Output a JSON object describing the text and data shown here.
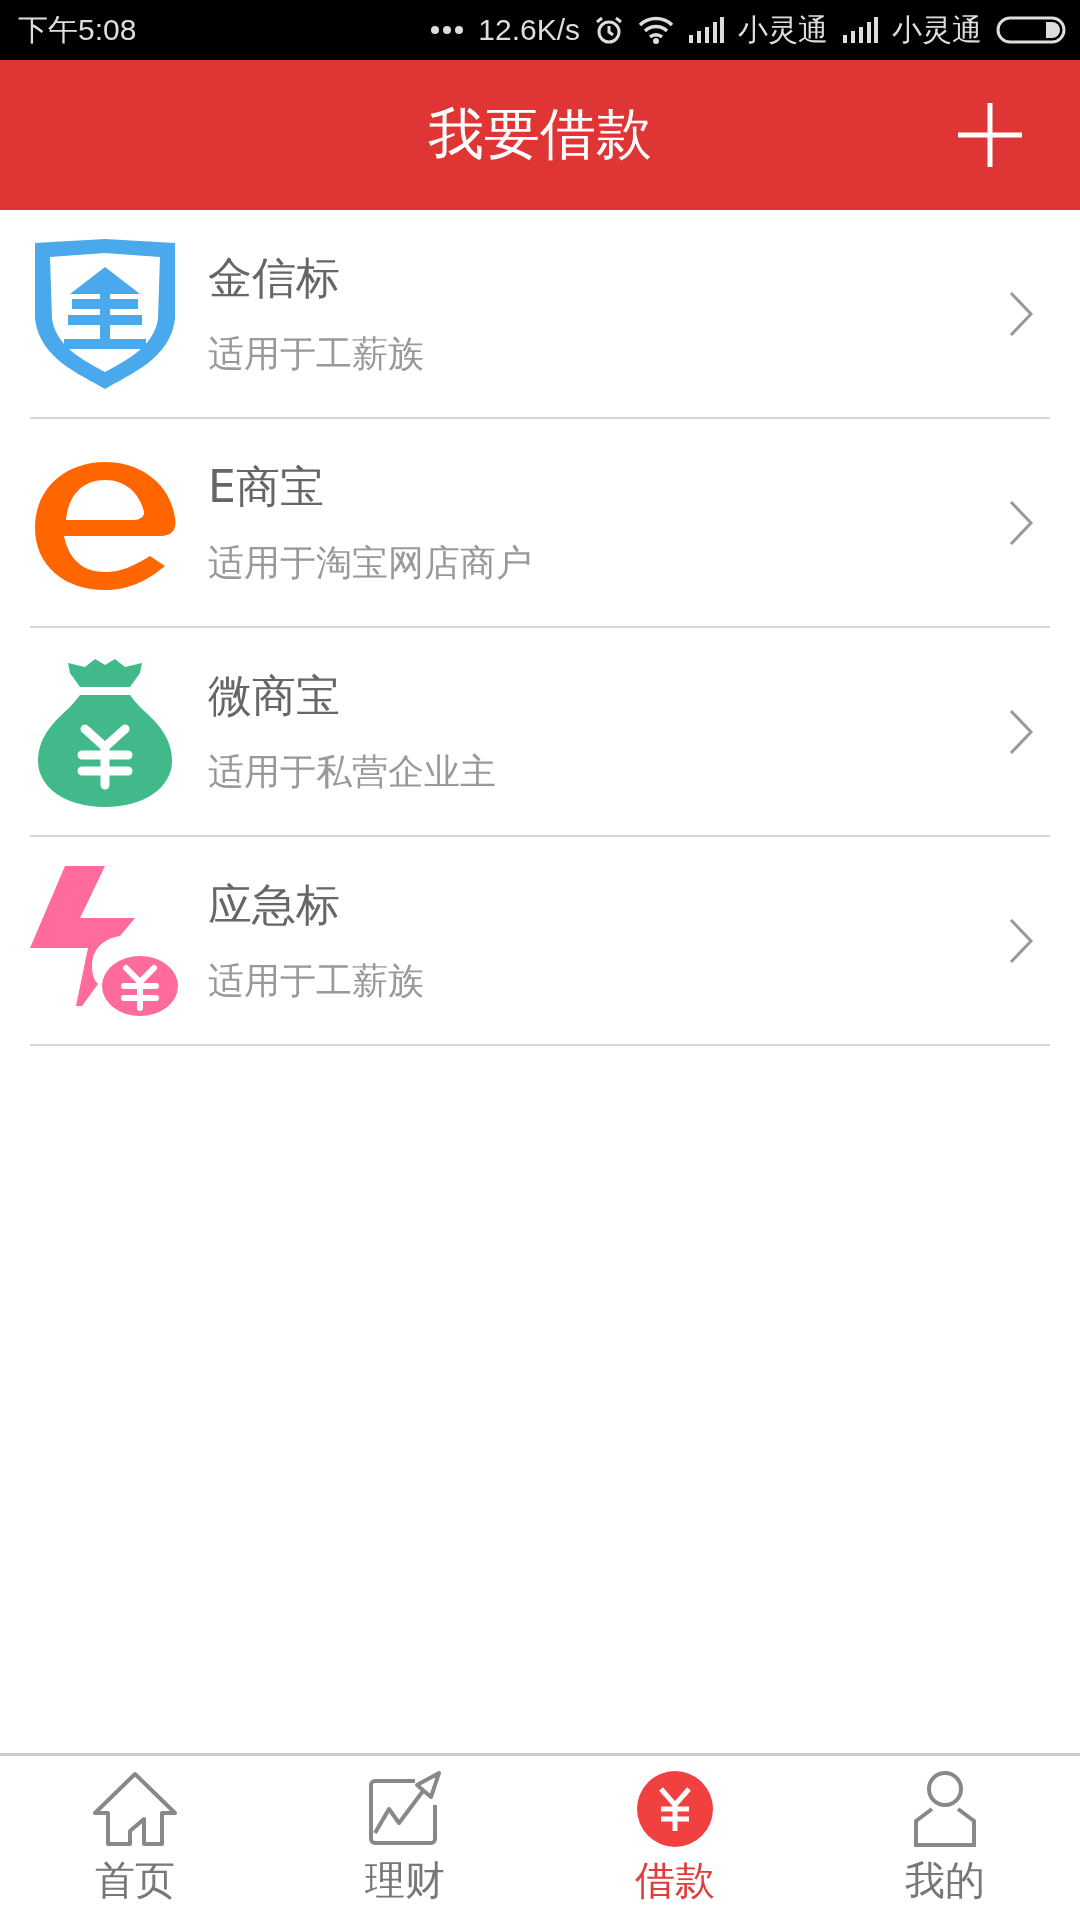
{
  "status_bar": {
    "time": "下午5:08",
    "speed": "12.6K/s",
    "carriers": [
      "小灵通",
      "小灵通"
    ]
  },
  "header": {
    "title": "我要借款"
  },
  "loans": [
    {
      "kind": "shield",
      "name": "金信标",
      "description": "适用于工薪族"
    },
    {
      "kind": "e",
      "name": "E商宝",
      "description": "适用于淘宝网店商户"
    },
    {
      "kind": "bag",
      "name": "微商宝",
      "description": "适用于私营企业主"
    },
    {
      "kind": "bolt",
      "name": "应急标",
      "description": "适用于工薪族"
    }
  ],
  "tab_bar": [
    {
      "kind": "home",
      "label": "首页",
      "selected": false
    },
    {
      "kind": "chart",
      "label": "理财",
      "selected": false
    },
    {
      "kind": "yen",
      "label": "借款",
      "selected": true
    },
    {
      "kind": "user",
      "label": "我的",
      "selected": false
    }
  ]
}
